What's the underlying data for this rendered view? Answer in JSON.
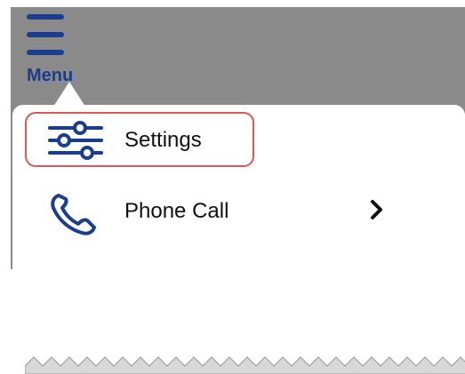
{
  "menu_button": {
    "label": "Menu"
  },
  "items": [
    {
      "label": "Settings",
      "icon": "sliders-icon",
      "highlighted": true
    },
    {
      "label": "Phone Call",
      "icon": "phone-icon",
      "has_submenu": true
    }
  ],
  "colors": {
    "accent": "#1a3d8f",
    "highlight_border": "#e05555",
    "backdrop": "#8a8a8a"
  }
}
